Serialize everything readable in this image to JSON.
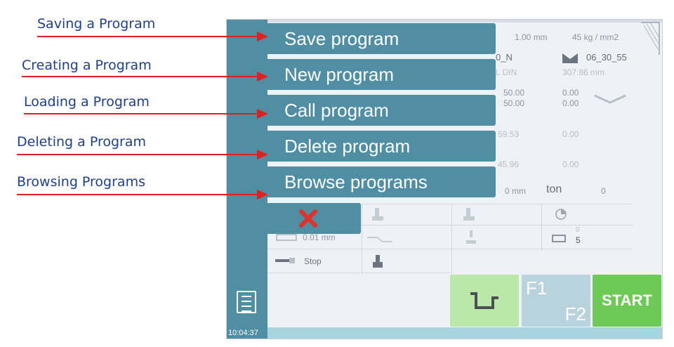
{
  "annotations": [
    {
      "label": "Saving a Program"
    },
    {
      "label": "Creating a Program"
    },
    {
      "label": "Loading a Program"
    },
    {
      "label": "Deleting a Program"
    },
    {
      "label": "Browsing Programs"
    }
  ],
  "menu": {
    "items": [
      {
        "label": "Save program"
      },
      {
        "label": "New program"
      },
      {
        "label": "Call program"
      },
      {
        "label": "Delete program"
      },
      {
        "label": "Browse programs"
      }
    ],
    "close_icon": "close-x-icon"
  },
  "header": {
    "thickness": "1.00 mm",
    "strength": "45 kg / mm2",
    "tool_left": "0_N",
    "tool_right": "06_30_55",
    "row2_left": "L DIN",
    "row2_right": "307.86 mm"
  },
  "values": {
    "r1a": "50.00",
    "r1b": "50.00",
    "r1c": "0.00",
    "r1d": "0.00",
    "r2a": "59.53",
    "r2b": "0.00",
    "r3a": "45.96",
    "r3b": "0.00",
    "mm": "0 mm",
    "ton_label": "ton",
    "ton_value": "0"
  },
  "grid": {
    "stop_label": "Stop",
    "dim_value": "0.01 mm",
    "count_top": "0",
    "count_bottom": "5"
  },
  "buttons": {
    "f1": "F1",
    "f2": "F2",
    "start": "START"
  },
  "status": {
    "time": "10:04:37"
  },
  "colors": {
    "annotation_text": "#1f3f8f",
    "arrow": "#e02020",
    "menu_bg": "#4f8ea3",
    "start_bg": "#6dca54"
  }
}
